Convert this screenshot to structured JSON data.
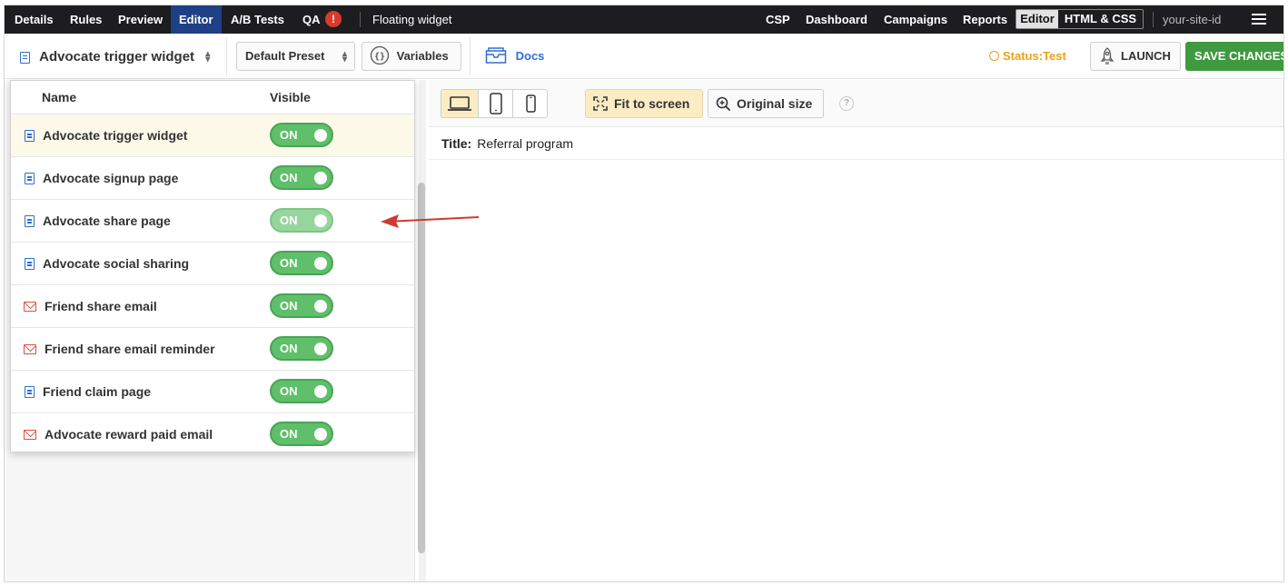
{
  "nav": {
    "tabs": [
      "Details",
      "Rules",
      "Preview",
      "Editor",
      "A/B Tests",
      "QA"
    ],
    "active_tab": "Editor",
    "qa_badge": "!",
    "widget_title": "Floating widget",
    "right_links": [
      "CSP",
      "Dashboard",
      "Campaigns",
      "Reports"
    ],
    "mode_options": [
      "Editor",
      "HTML & CSS"
    ],
    "active_mode": "Editor",
    "site_id": "your-site-id"
  },
  "toolbar": {
    "widget_select": "Advocate trigger widget",
    "preset": "Default Preset",
    "variables": "Variables",
    "docs": "Docs",
    "status_label": "Status:",
    "status_value": "Test",
    "launch": "LAUNCH",
    "save": "SAVE CHANGES"
  },
  "dropdown": {
    "col_name": "Name",
    "col_visible": "Visible",
    "rows": [
      {
        "label": "Advocate trigger widget",
        "type": "page",
        "visible": "ON"
      },
      {
        "label": "Advocate signup page",
        "type": "page",
        "visible": "ON"
      },
      {
        "label": "Advocate share page",
        "type": "page",
        "visible": "ON"
      },
      {
        "label": "Advocate social sharing",
        "type": "page",
        "visible": "ON"
      },
      {
        "label": "Friend share email",
        "type": "email",
        "visible": "ON"
      },
      {
        "label": "Friend share email reminder",
        "type": "email",
        "visible": "ON"
      },
      {
        "label": "Friend claim page",
        "type": "page",
        "visible": "ON"
      },
      {
        "label": "Advocate reward paid email",
        "type": "email",
        "visible": "ON"
      }
    ]
  },
  "canvas": {
    "fit_to_screen": "Fit to screen",
    "original_size": "Original size",
    "help": "?",
    "title_label": "Title:",
    "title_value": "Referral program"
  },
  "colors": {
    "nav_bg": "#1d1d1f",
    "active_tab": "#1f3f86",
    "accent_blue": "#2f6fd1",
    "toggle_green": "#5fbf6a",
    "save_green": "#3f9a3f",
    "status_amber": "#e8a317",
    "annotation_arrow": "#d03a32"
  },
  "icons": [
    "document-icon",
    "mail-icon",
    "variables-icon",
    "docs-icon",
    "rocket-icon",
    "laptop-icon",
    "tablet-icon",
    "phone-icon",
    "fit-screen-icon",
    "zoom-in-icon",
    "hamburger-icon"
  ]
}
